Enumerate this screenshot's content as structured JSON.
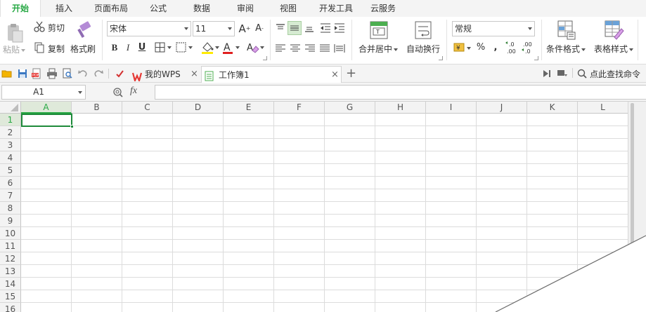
{
  "menu": {
    "tabs": [
      {
        "label": "开始",
        "active": true
      },
      {
        "label": "插入"
      },
      {
        "label": "页面布局"
      },
      {
        "label": "公式"
      },
      {
        "label": "数据"
      },
      {
        "label": "审阅"
      },
      {
        "label": "视图"
      },
      {
        "label": "开发工具"
      },
      {
        "label": "云服务"
      }
    ]
  },
  "ribbon": {
    "paste_label": "粘贴",
    "cut_label": "剪切",
    "copy_label": "复制",
    "format_painter_label": "格式刷",
    "font_name": "宋体",
    "font_size": "11",
    "bold": "B",
    "italic": "I",
    "underline": "U",
    "merge_center_label": "合并居中",
    "wrap_text_label": "自动换行",
    "number_format": "常规",
    "percent": "%",
    "comma": "\"",
    "conditional_format_label": "条件格式",
    "table_style_label": "表格样式",
    "decimal_increase": ".00\n.0",
    "decimal_decrease": ".0\n.00"
  },
  "quickbar": {
    "tabs": [
      {
        "label": "我的WPS"
      },
      {
        "label": "工作簿1",
        "active": true
      }
    ],
    "search_label": "点此查找命令"
  },
  "formula_bar": {
    "cell_reference": "A1",
    "fx_label": "fx"
  },
  "sheet": {
    "columns": [
      "A",
      "B",
      "C",
      "D",
      "E",
      "F",
      "G",
      "H",
      "I",
      "J",
      "K",
      "L"
    ],
    "rows": [
      "1",
      "2",
      "3",
      "4",
      "5",
      "6",
      "7",
      "8",
      "9",
      "10",
      "11",
      "12",
      "13",
      "14",
      "15",
      "16"
    ],
    "selected_column": "A",
    "selected_row": "1"
  },
  "colors": {
    "accent": "#27a844",
    "selection": "#1e8a3a",
    "ribbon_bg": "#ffffff",
    "toolbar_bg": "#f4f4f4"
  }
}
